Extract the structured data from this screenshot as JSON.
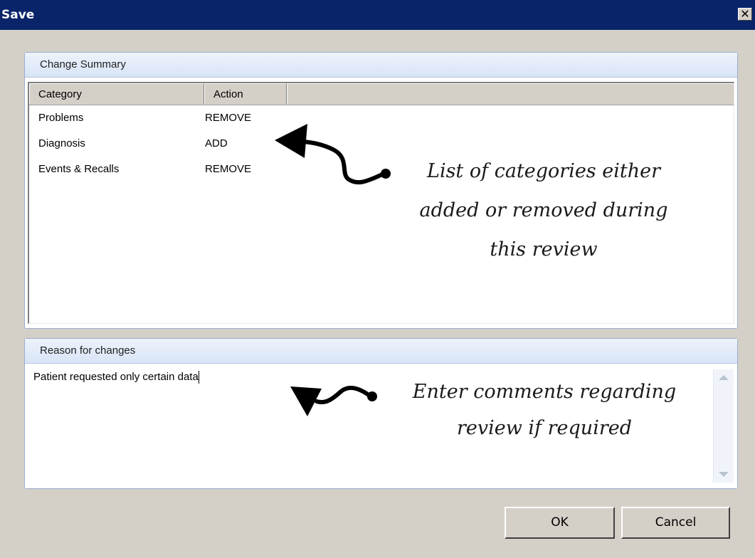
{
  "window": {
    "title": "Save",
    "close_glyph": "✕"
  },
  "change_summary": {
    "header": "Change Summary",
    "columns": [
      "Category",
      "Action"
    ],
    "rows": [
      {
        "category": "Problems",
        "action": "REMOVE"
      },
      {
        "category": "Diagnosis",
        "action": "ADD"
      },
      {
        "category": "Events & Recalls",
        "action": "REMOVE"
      }
    ]
  },
  "reason": {
    "header": "Reason for changes",
    "value": "Patient requested only certain data"
  },
  "buttons": {
    "ok": "OK",
    "cancel": "Cancel"
  },
  "annotations": {
    "categories_lines": [
      "List of categories either",
      "added or removed during",
      "this review"
    ],
    "comments_lines": [
      "Enter comments regarding",
      "review if required"
    ]
  },
  "colors": {
    "titlebar": "#0a246a",
    "dialog_bg": "#d4d0c8",
    "group_border": "#9aaed0"
  }
}
